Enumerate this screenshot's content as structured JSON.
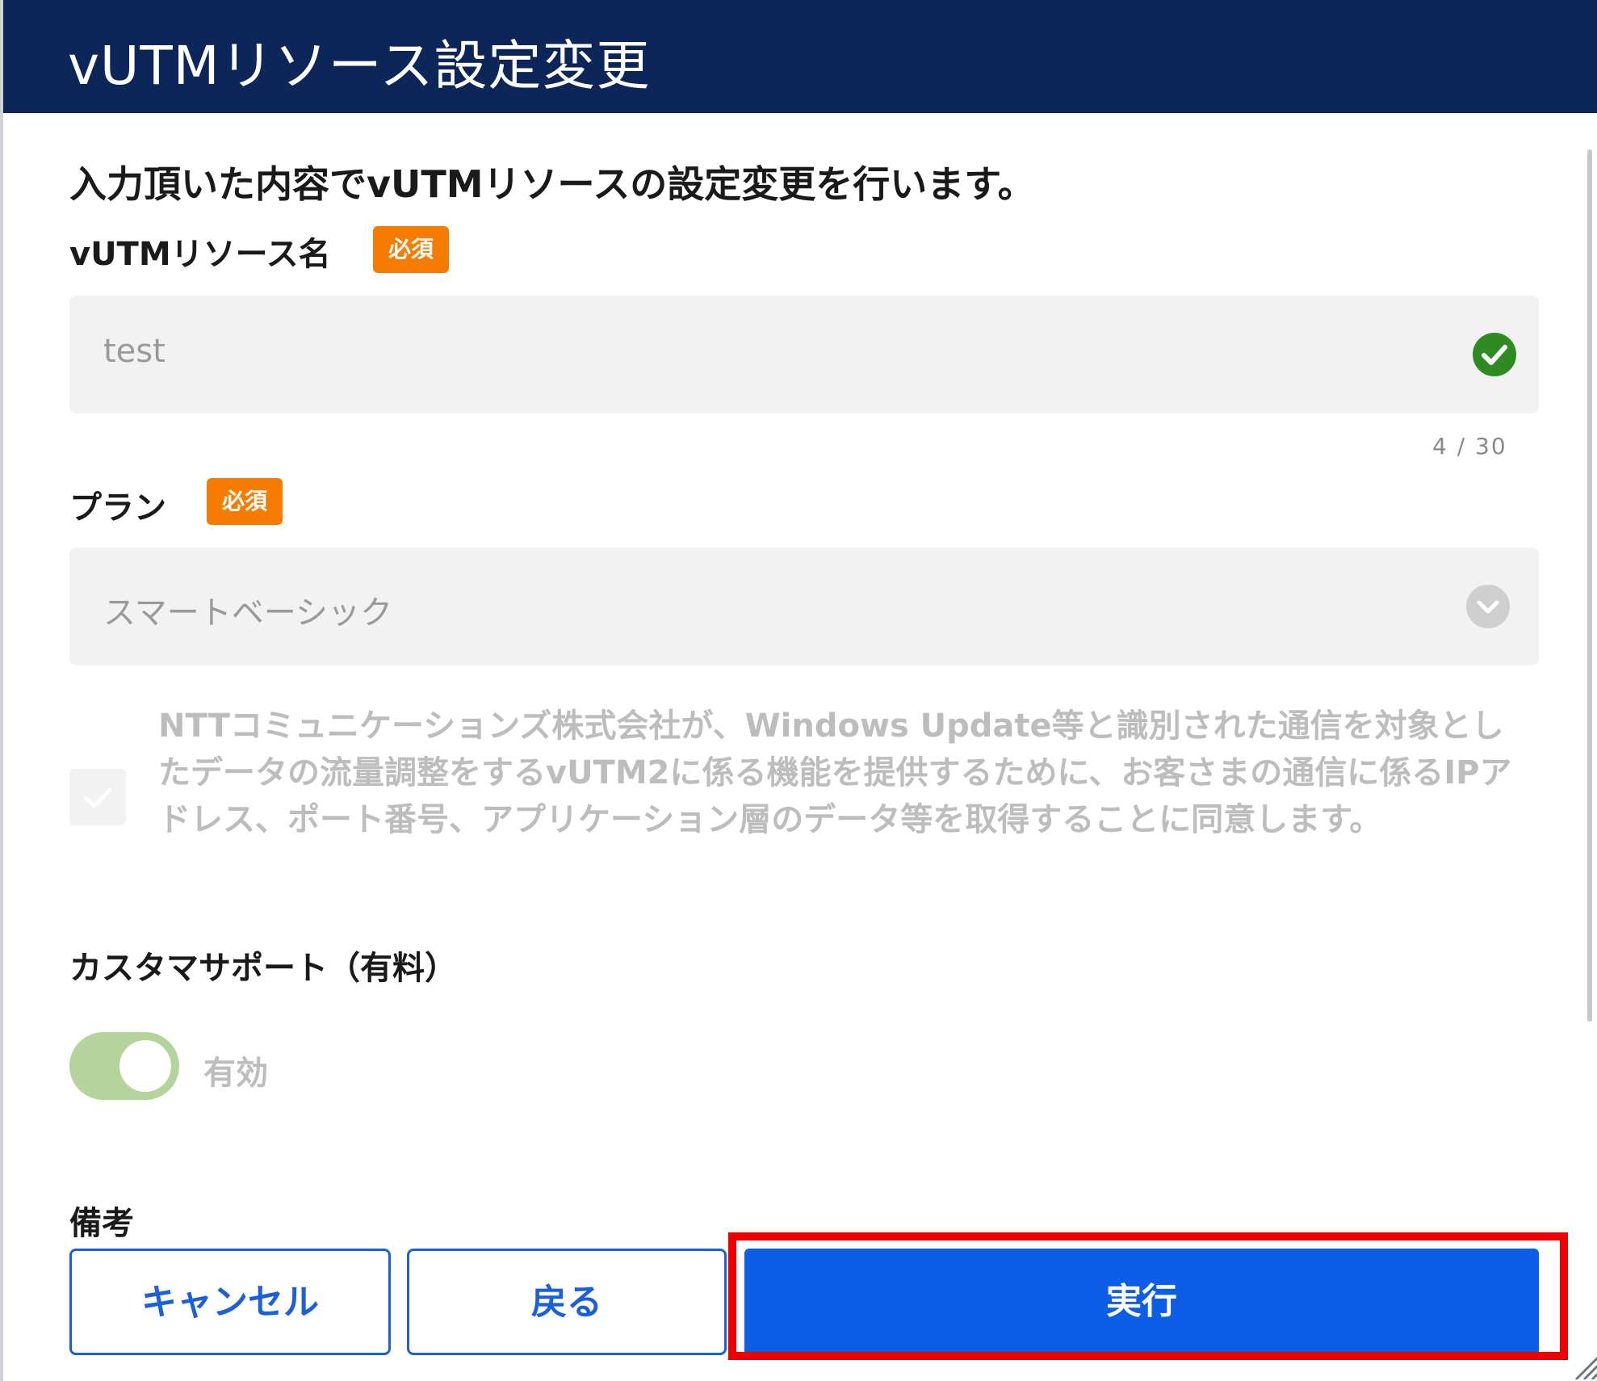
{
  "dialog": {
    "title": "vUTMリソース設定変更",
    "intro": "入力頂いた内容でvUTMリソースの設定変更を行います。"
  },
  "resource_name": {
    "label": "vUTMリソース名",
    "required_badge": "必須",
    "value": "test",
    "counter": "4 / 30",
    "valid_icon": "check-circle-icon"
  },
  "plan": {
    "label": "プラン",
    "required_badge": "必須",
    "selected": "スマートベーシック",
    "dropdown_icon": "chevron-down-icon"
  },
  "consent": {
    "text": "NTTコミュニケーションズ株式会社が、Windows Update等と識別された通信を対象としたデータの流量調整をするvUTM2に係る機能を提供するために、お客さまの通信に係るIPアドレス、ポート番号、アプリケーション層のデータ等を取得することに同意します。",
    "checked": true
  },
  "custom_support": {
    "label": "カスタマサポート（有料）",
    "toggle_label": "有効",
    "enabled": true
  },
  "remarks": {
    "label": "備考"
  },
  "actions": {
    "cancel": "キャンセル",
    "back": "戻る",
    "execute": "実行"
  },
  "colors": {
    "header_bg": "#0c2659",
    "required_badge": "#f57c00",
    "valid_green": "#2e8b22",
    "primary_button": "#0d5ee6",
    "toggle_on": "#b5d49c",
    "highlight": "#ee0000"
  }
}
